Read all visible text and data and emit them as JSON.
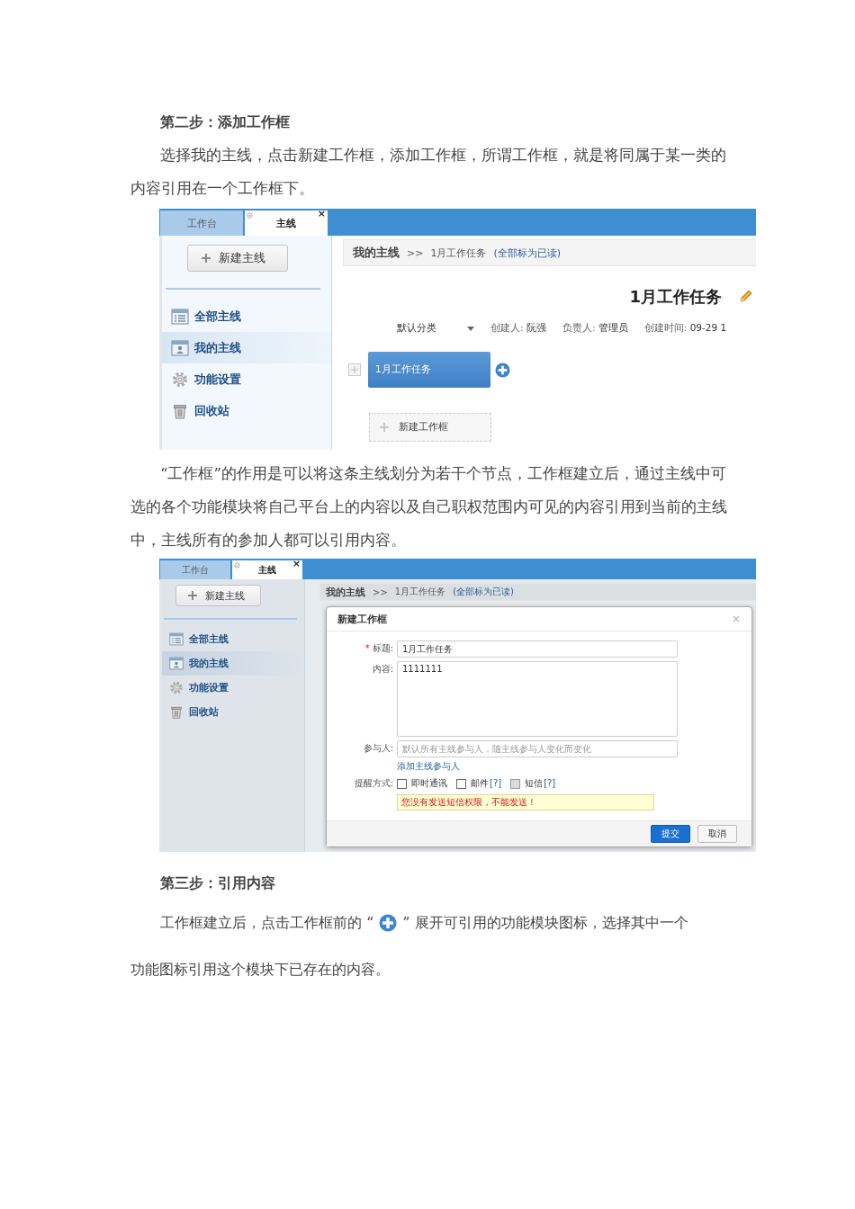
{
  "step2_heading": "第二步：添加工作框",
  "step2_paragraph": "选择我的主线，点击新建工作框，添加工作框，所谓工作框，就是将同属于某一类的内容引用在一个工作框下。",
  "screenshot_1": {
    "tabs": [
      {
        "label": "工作台",
        "selected": false
      },
      {
        "label": "主线",
        "selected": true,
        "close": "×"
      }
    ],
    "new_mainline_button": "新建主线",
    "nav": [
      {
        "label": "全部主线",
        "kind": "list",
        "selected": false
      },
      {
        "label": "我的主线",
        "kind": "profile",
        "selected": true
      },
      {
        "label": "功能设置",
        "kind": "settings",
        "selected": false
      },
      {
        "label": "回收站",
        "kind": "trash",
        "selected": false
      }
    ],
    "breadcrumb": {
      "current": "我的主线",
      "separator": ">>",
      "item": "1月工作任务",
      "link": "(全部标为已读)"
    },
    "title": "1月工作任务",
    "category": "默认分类",
    "meta": [
      {
        "label": "创建人:",
        "value": "阮强"
      },
      {
        "label": "负责人:",
        "value": "管理员"
      },
      {
        "label": "创建时间:",
        "value": "09-29 1"
      }
    ],
    "frames": [
      {
        "label": "1月工作任务"
      }
    ],
    "new_frame_button": "新建工作框"
  },
  "paragraph_2": "“工作框”的作用是可以将这条主线划分为若干个节点，工作框建立后，通过主线中可选的各个功能模块将自己平台上的内容以及自己职权范围内可见的内容引用到当前的主线中，主线所有的参加人都可以引用内容。",
  "screenshot_2": {
    "tabs": [
      {
        "label": "工作台",
        "selected": false
      },
      {
        "label": "主线",
        "selected": true,
        "close": "×"
      }
    ],
    "new_mainline_button": "新建主线",
    "nav": [
      {
        "label": "全部主线",
        "kind": "list",
        "selected": false
      },
      {
        "label": "我的主线",
        "kind": "profile",
        "selected": true
      },
      {
        "label": "功能设置",
        "kind": "settings",
        "selected": false
      },
      {
        "label": "回收站",
        "kind": "trash",
        "selected": false
      }
    ],
    "breadcrumb": {
      "current": "我的主线",
      "separator": ">>",
      "item": "1月工作任务",
      "link": "(全部标为已读)"
    },
    "dialog": {
      "title": "新建工作框",
      "close": "×",
      "fields": [
        {
          "label": "标题:",
          "required_mark": "*",
          "kind": "input",
          "value": "1月工作任务"
        },
        {
          "label": "内容:",
          "kind": "textarea",
          "value": "1111111"
        },
        {
          "label": "参与人:",
          "kind": "input",
          "placeholder": "默认所有主线参与人，随主线参与人变化而变化"
        }
      ],
      "add_participant_link": "添加主线参与人",
      "reminder_label": "提醒方式:",
      "reminders": [
        {
          "label": "即时通讯",
          "checked": false,
          "disabled": false
        },
        {
          "label": "邮件",
          "help": "[?]",
          "checked": false,
          "disabled": false
        },
        {
          "label": "短信",
          "help": "[?]",
          "checked": false,
          "disabled": true
        }
      ],
      "warning": "您没有发送短信权限，不能发送！",
      "buttons": [
        {
          "label": "提交",
          "kind": "primary"
        },
        {
          "label": "取消",
          "kind": "secondary"
        }
      ]
    }
  },
  "step3_heading": "第三步：引用内容",
  "step3_paragraph": {
    "before_icon": "工作框建立后，点击工作框前的 “",
    "after_icon": "” 展开可引用的功能模块图标，选择其中一个",
    "continuation": "功能图标引用这个模块下已存在的内容。"
  }
}
